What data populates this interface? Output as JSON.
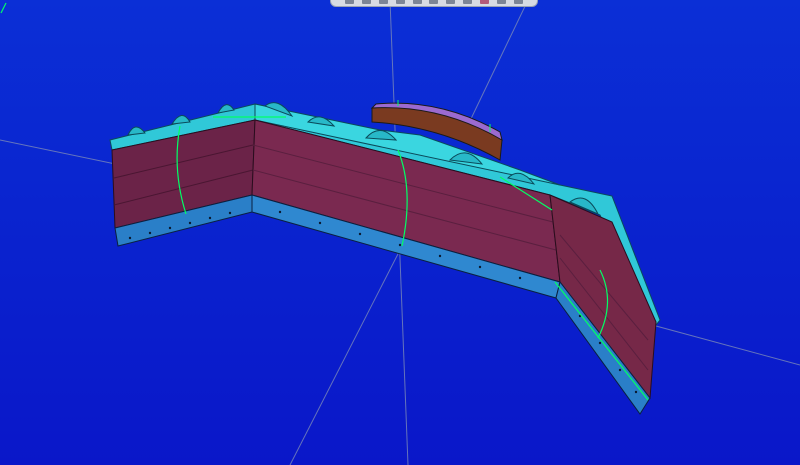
{
  "app": {
    "viewport": "3d-model-viewport",
    "model": "plow-blade-assembly"
  },
  "toolbar": {
    "tools": [
      {
        "icon": "view-front-icon"
      },
      {
        "icon": "view-top-icon"
      },
      {
        "icon": "rotate-icon"
      },
      {
        "icon": "pan-icon"
      },
      {
        "icon": "zoom-icon"
      },
      {
        "icon": "fit-icon"
      },
      {
        "icon": "section-icon"
      },
      {
        "icon": "render-mode-icon"
      },
      {
        "icon": "measure-icon"
      },
      {
        "icon": "color-icon"
      },
      {
        "icon": "settings-icon"
      }
    ]
  },
  "colors": {
    "background_top": "#0b2fd6",
    "background_bottom": "#0a17c9",
    "moldboard_face": "#7a2950",
    "moldboard_dark": "#5a1f3f",
    "frame_top": "#30c8d8",
    "cutting_edge": "#2a7fc8",
    "edge_lines": "#00ff66",
    "mount_plate": "#7a3a20"
  }
}
